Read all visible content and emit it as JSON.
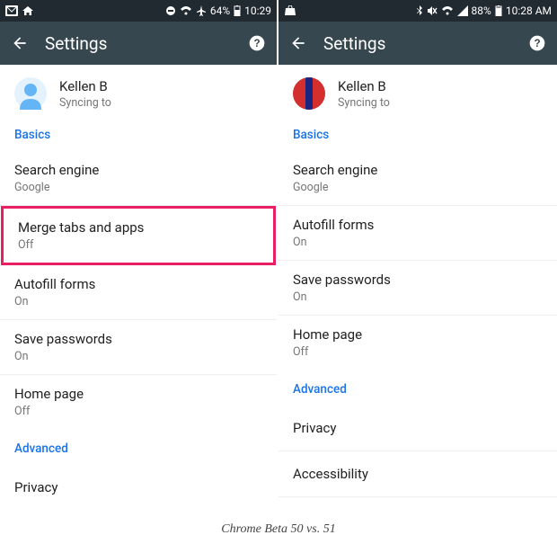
{
  "caption": "Chrome Beta 50 vs. 51",
  "left": {
    "statusbar": {
      "battery": "64%",
      "time": "10:29"
    },
    "appbar": {
      "title": "Settings"
    },
    "account": {
      "name": "Kellen B",
      "sync": "Syncing to"
    },
    "sections": {
      "basics_label": "Basics",
      "search": {
        "label": "Search engine",
        "value": "Google"
      },
      "merge": {
        "label": "Merge tabs and apps",
        "value": "Off"
      },
      "autofill": {
        "label": "Autofill forms",
        "value": "On"
      },
      "savepw": {
        "label": "Save passwords",
        "value": "On"
      },
      "home": {
        "label": "Home page",
        "value": "Off"
      },
      "advanced_label": "Advanced",
      "privacy": {
        "label": "Privacy"
      }
    }
  },
  "right": {
    "statusbar": {
      "battery": "88%",
      "time": "10:28 AM"
    },
    "appbar": {
      "title": "Settings"
    },
    "account": {
      "name": "Kellen B",
      "sync": "Syncing to"
    },
    "sections": {
      "basics_label": "Basics",
      "search": {
        "label": "Search engine",
        "value": "Google"
      },
      "autofill": {
        "label": "Autofill forms",
        "value": "On"
      },
      "savepw": {
        "label": "Save passwords",
        "value": "On"
      },
      "home": {
        "label": "Home page",
        "value": "Off"
      },
      "advanced_label": "Advanced",
      "privacy": {
        "label": "Privacy"
      },
      "accessibility": {
        "label": "Accessibility"
      }
    }
  }
}
